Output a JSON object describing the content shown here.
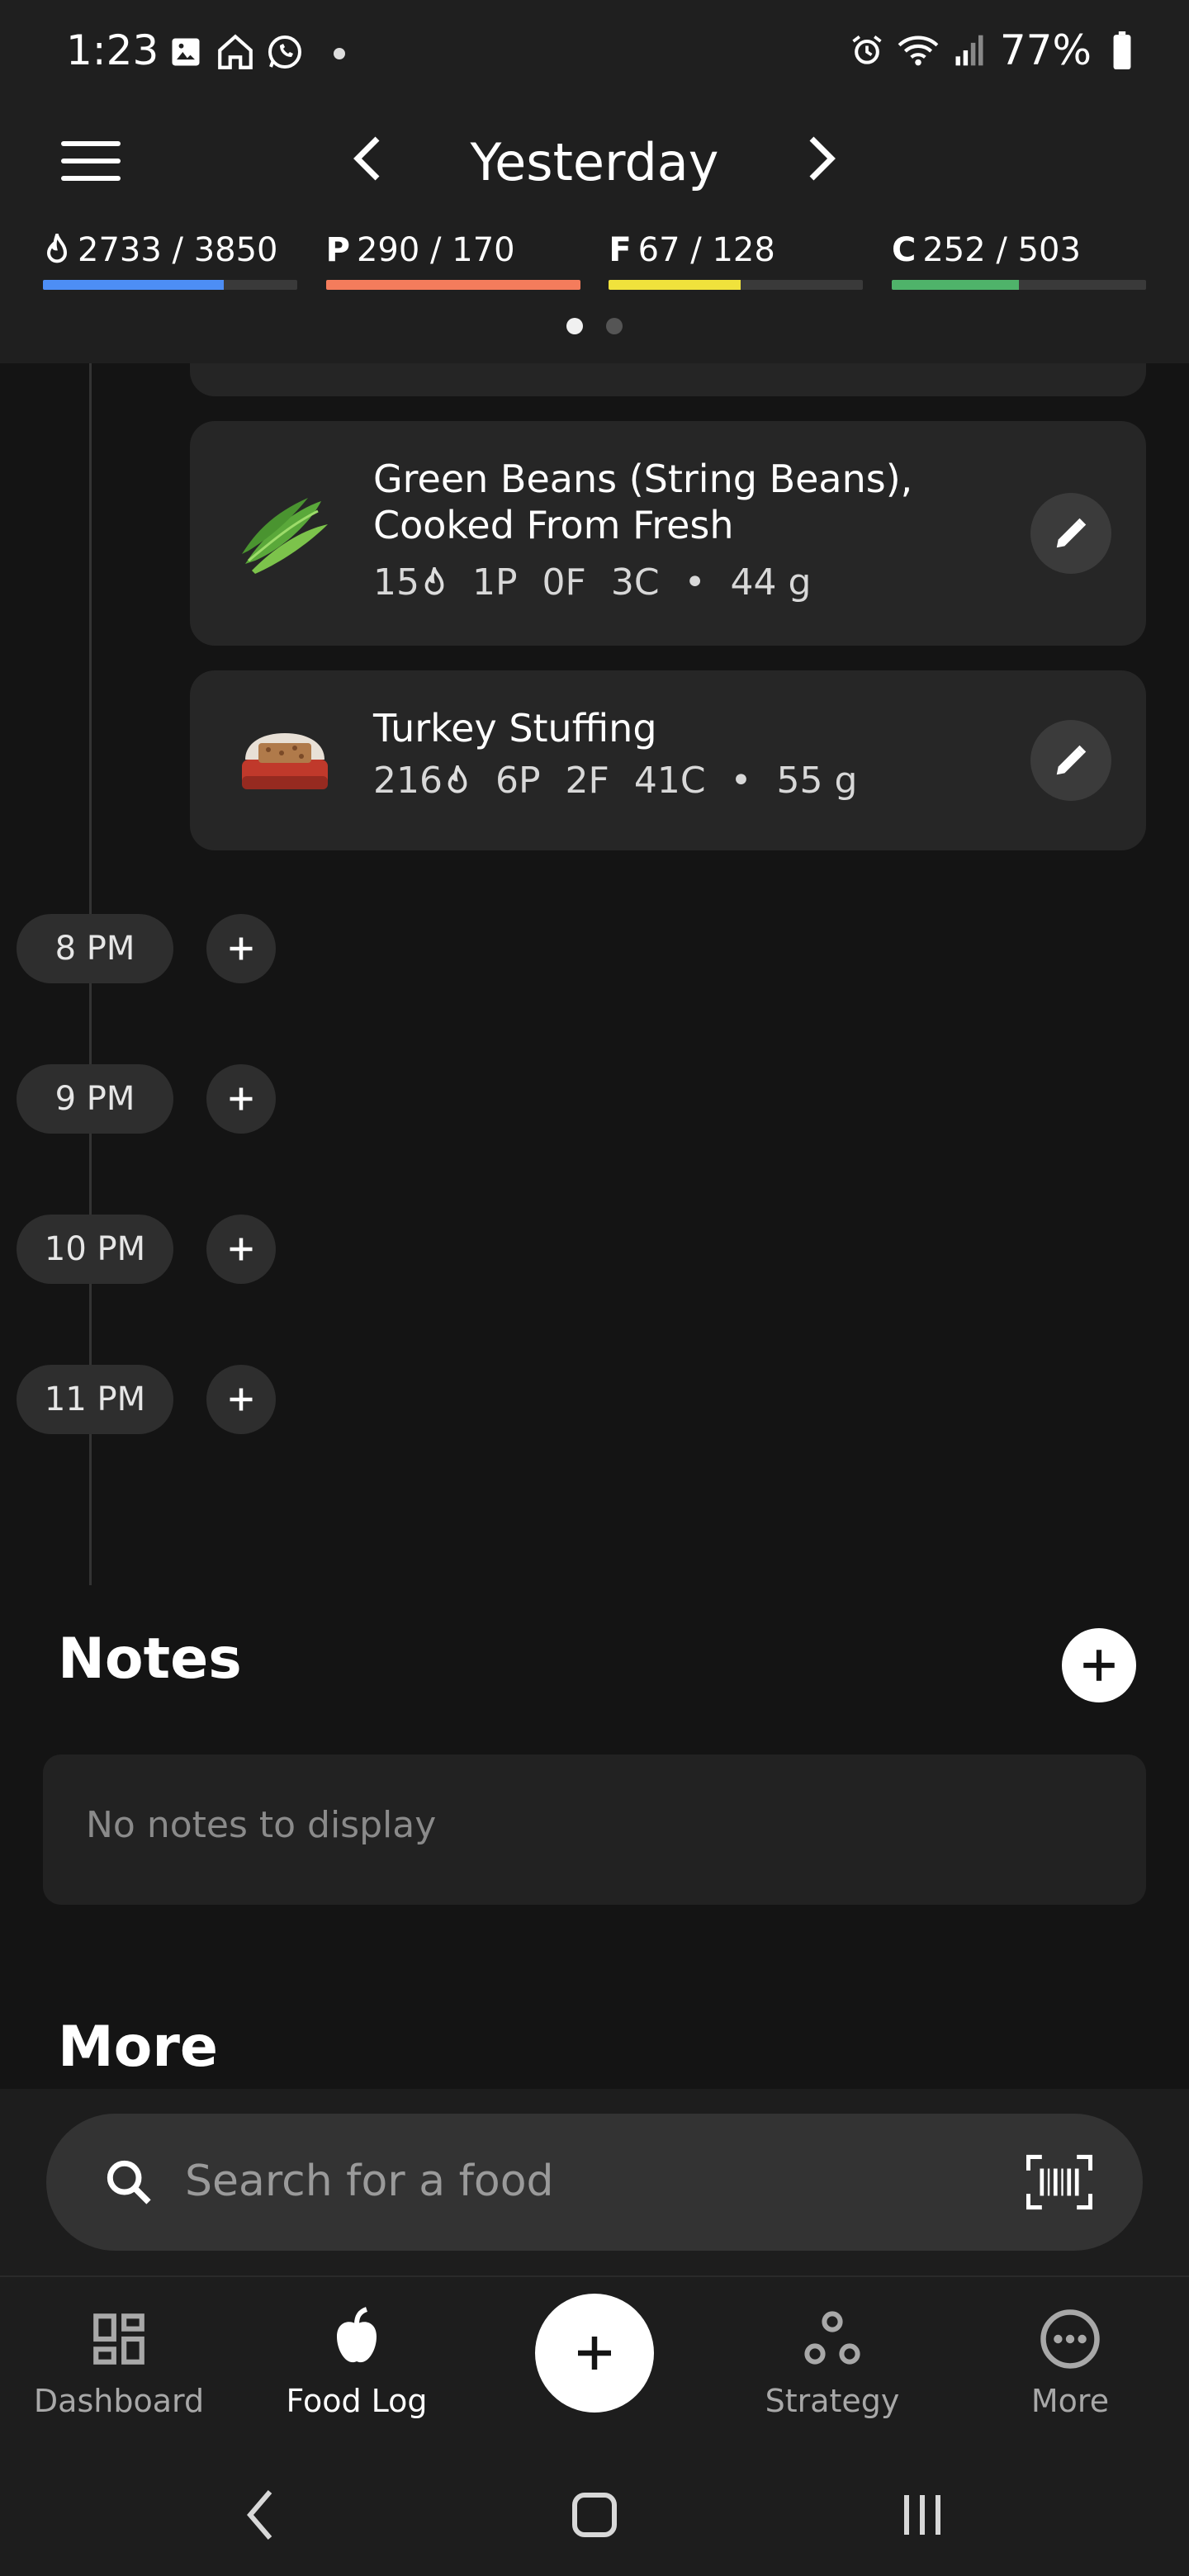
{
  "status_bar": {
    "time": "1:23",
    "battery": "77%",
    "left_icons": [
      "gallery-icon",
      "home-icon",
      "whatsapp-icon"
    ],
    "right_icons": [
      "alarm-icon",
      "wifi-icon",
      "signal-icon",
      "battery-icon"
    ]
  },
  "header": {
    "title": "Yesterday",
    "page_count": 2,
    "active_page": 0
  },
  "macros": [
    {
      "letter": "",
      "icon": "flame-icon",
      "value": "2733 / 3850",
      "color": "#4d8ef5",
      "progress": 0.71
    },
    {
      "letter": "P",
      "value": "290 / 170",
      "color": "#f47c5c",
      "progress": 1.0
    },
    {
      "letter": "F",
      "value": "67 / 128",
      "color": "#f0e23c",
      "progress": 0.52
    },
    {
      "letter": "C",
      "value": "252 / 503",
      "color": "#4fb36a",
      "progress": 0.5
    }
  ],
  "food_entries": [
    {
      "name_line1": "Green Beans (String Beans),",
      "name_line2": "Cooked From Fresh",
      "calories": "15",
      "protein": "1P",
      "fat": "0F",
      "carbs": "3C",
      "weight": "44 g",
      "image": "green-beans-image"
    },
    {
      "name_line1": "Turkey Stuffing",
      "calories": "216",
      "protein": "6P",
      "fat": "2F",
      "carbs": "41C",
      "weight": "55 g",
      "image": "stuffing-image"
    }
  ],
  "time_slots": [
    "8 PM",
    "9 PM",
    "10 PM",
    "11 PM"
  ],
  "notes": {
    "title": "Notes",
    "empty_text": "No notes to display"
  },
  "more": {
    "title": "More"
  },
  "search": {
    "placeholder": "Search for a food"
  },
  "bottom_nav": {
    "items": [
      {
        "label": "Dashboard",
        "icon": "dashboard-icon"
      },
      {
        "label": "Food Log",
        "icon": "apple-icon",
        "active": true
      },
      {
        "label": "Strategy",
        "icon": "strategy-icon"
      },
      {
        "label": "More",
        "icon": "more-icon"
      }
    ]
  }
}
